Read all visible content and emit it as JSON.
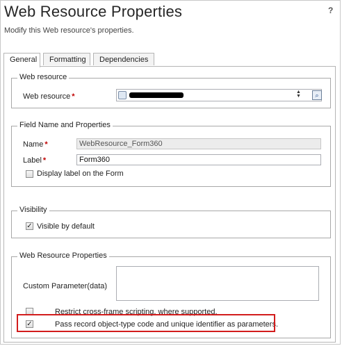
{
  "dialog": {
    "title": "Web Resource Properties",
    "subtitle": "Modify this Web resource's properties.",
    "help_glyph": "?"
  },
  "tabs": [
    {
      "label": "General",
      "active": true
    },
    {
      "label": "Formatting",
      "active": false
    },
    {
      "label": "Dependencies",
      "active": false
    }
  ],
  "web_resource_section": {
    "legend": "Web resource",
    "field_label": "Web resource",
    "required_mark": "*",
    "lookup_value_redacted": true,
    "icon": "web-resource-icon",
    "lookup_button_icon": "lookup-icon"
  },
  "field_name_section": {
    "legend": "Field Name and Properties",
    "name_label": "Name",
    "name_value": "WebResource_Form360",
    "label_label": "Label",
    "label_value": "Form360",
    "required_mark": "*",
    "display_label_text": "Display label on the Form",
    "display_label_checked": false
  },
  "visibility_section": {
    "legend": "Visibility",
    "visible_text": "Visible by default",
    "visible_checked": true
  },
  "properties_section": {
    "legend": "Web Resource Properties",
    "custom_param_label": "Custom Parameter(data)",
    "custom_param_value": "",
    "restrict_text": "Restrict cross-frame scripting, where supported.",
    "restrict_checked": false,
    "pass_record_text": "Pass record object-type code and unique identifier as parameters.",
    "pass_record_checked": true
  },
  "colors": {
    "highlight": "#d21c1c",
    "required": "#c00000"
  }
}
